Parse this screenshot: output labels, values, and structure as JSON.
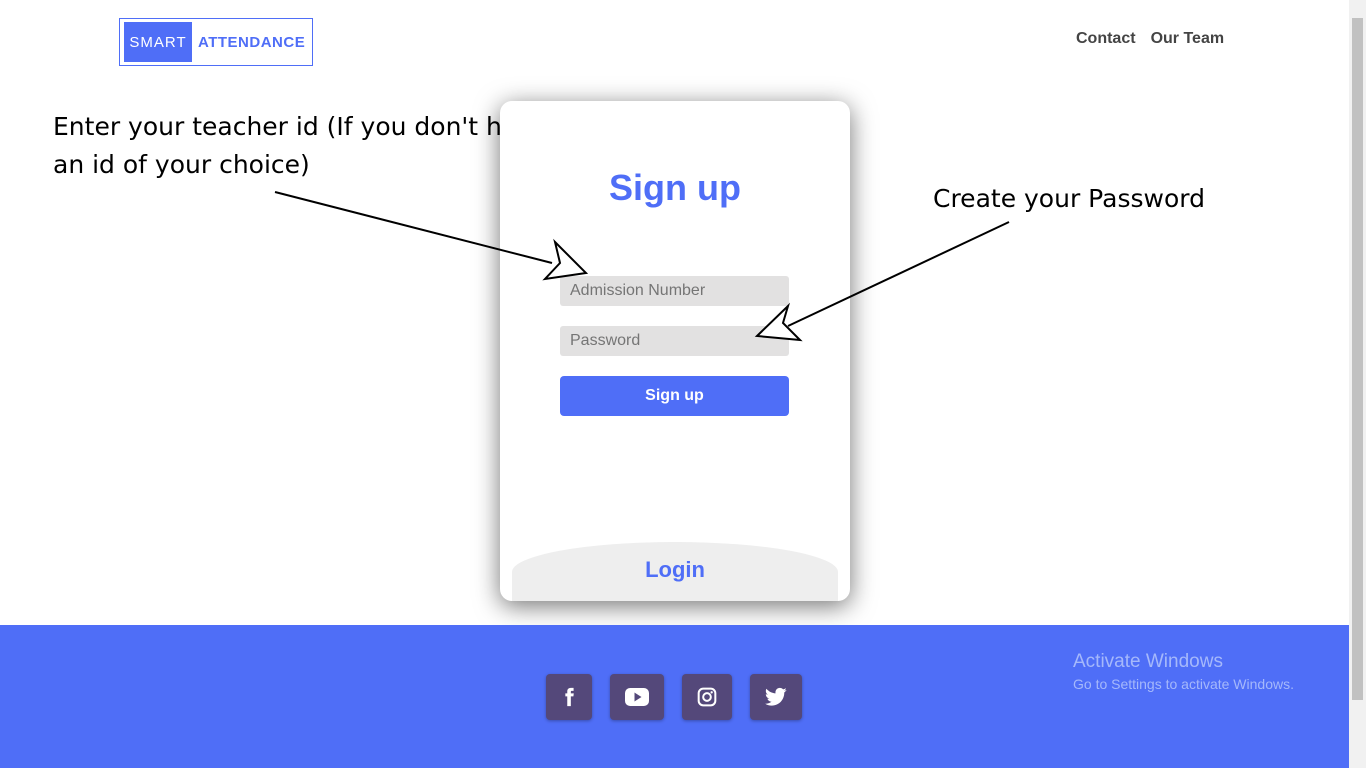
{
  "header": {
    "logo_left": "SMART",
    "logo_right": "ATTENDANCE",
    "nav": [
      "Contact",
      "Our Team"
    ]
  },
  "annotations": {
    "left": "Enter your teacher id (If you don't have one create an id of your choice)",
    "right": "Create your Password"
  },
  "form": {
    "title": "Sign up",
    "admission_placeholder": "Admission Number",
    "password_placeholder": "Password",
    "signup_button": "Sign up",
    "login_label": "Login"
  },
  "footer": {
    "social_icons": [
      "facebook-icon",
      "youtube-icon",
      "instagram-icon",
      "twitter-icon"
    ],
    "watermark_title": "Activate Windows",
    "watermark_sub": "Go to Settings to activate Windows."
  },
  "colors": {
    "accent": "#4f6ef7",
    "social_bg": "#54487a",
    "input_bg": "#e2e1e1"
  }
}
